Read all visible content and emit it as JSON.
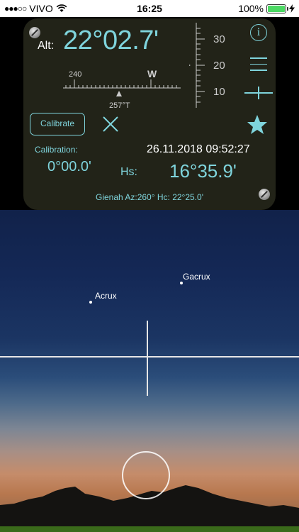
{
  "status_bar": {
    "carrier": "VIVO",
    "time": "16:25",
    "battery": "100%"
  },
  "panel": {
    "alt_label": "Alt:",
    "alt_value": "22°02.7'",
    "vscale_labels": [
      "30",
      "20",
      "10"
    ],
    "hscale": {
      "left_label": "240",
      "direction_label": "W",
      "bearing": "257°T"
    },
    "calibrate_label": "Calibrate",
    "calibration_label": "Calibration:",
    "calibration_value": "0°00.0'",
    "datetime": "26.11.2018 09:52:27",
    "hs_label": "Hs:",
    "hs_value": "16°35.9'",
    "star_info": "Gienah  Az:260° Hc: 22°25.0'"
  },
  "sky": {
    "stars": [
      {
        "name": "Gacrux"
      },
      {
        "name": "Acrux"
      }
    ]
  },
  "colors": {
    "accent": "#7fd4dc",
    "panel_bg": "#222318"
  }
}
